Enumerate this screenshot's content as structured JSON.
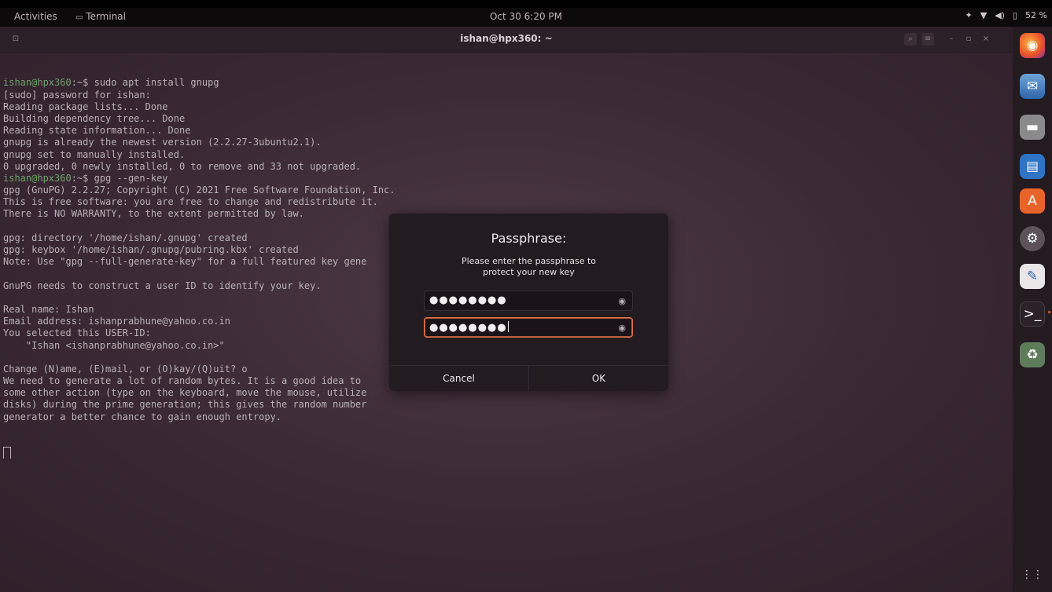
{
  "topbar": {
    "activities": "Activities",
    "app_menu": "Terminal",
    "clock": "Oct 30  6:20 PM",
    "battery": "52 %"
  },
  "terminal": {
    "window_title": "ishan@hpx360: ~",
    "lines": [
      {
        "prompt": "ishan@hpx360",
        "suffix": ":~$ ",
        "text": "sudo apt install gnupg"
      },
      {
        "text": "[sudo] password for ishan:"
      },
      {
        "text": "Reading package lists... Done"
      },
      {
        "text": "Building dependency tree... Done"
      },
      {
        "text": "Reading state information... Done"
      },
      {
        "text": "gnupg is already the newest version (2.2.27-3ubuntu2.1)."
      },
      {
        "text": "gnupg set to manually installed."
      },
      {
        "text": "0 upgraded, 0 newly installed, 0 to remove and 33 not upgraded."
      },
      {
        "prompt": "ishan@hpx360",
        "suffix": ":~$ ",
        "text": "gpg --gen-key"
      },
      {
        "text": "gpg (GnuPG) 2.2.27; Copyright (C) 2021 Free Software Foundation, Inc."
      },
      {
        "text": "This is free software: you are free to change and redistribute it."
      },
      {
        "text": "There is NO WARRANTY, to the extent permitted by law."
      },
      {
        "text": ""
      },
      {
        "text": "gpg: directory '/home/ishan/.gnupg' created"
      },
      {
        "text": "gpg: keybox '/home/ishan/.gnupg/pubring.kbx' created"
      },
      {
        "text": "Note: Use \"gpg --full-generate-key\" for a full featured key gene"
      },
      {
        "text": ""
      },
      {
        "text": "GnuPG needs to construct a user ID to identify your key."
      },
      {
        "text": ""
      },
      {
        "text": "Real name: Ishan"
      },
      {
        "text": "Email address: ishanprabhune@yahoo.co.in"
      },
      {
        "text": "You selected this USER-ID:"
      },
      {
        "text": "    \"Ishan <ishanprabhune@yahoo.co.in>\""
      },
      {
        "text": ""
      },
      {
        "text": "Change (N)ame, (E)mail, or (O)kay/(Q)uit? o"
      },
      {
        "text": "We need to generate a lot of random bytes. It is a good idea to"
      },
      {
        "text": "some other action (type on the keyboard, move the mouse, utilize"
      },
      {
        "text": "disks) during the prime generation; this gives the random number"
      },
      {
        "text": "generator a better chance to gain enough entropy."
      }
    ]
  },
  "dialog": {
    "title": "Passphrase:",
    "message_line1": "Please enter the passphrase to",
    "message_line2": "protect your new key",
    "field1_value": "●●●●●●●●",
    "field2_value": "●●●●●●●●",
    "cancel_label": "Cancel",
    "ok_label": "OK"
  },
  "icons": {
    "window_menu": "terminal-icon",
    "search": "search-icon",
    "hamburger": "menu-icon",
    "minimize": "minimize-icon",
    "maximize": "maximize-icon",
    "close": "close-icon",
    "eye": "eye-icon"
  },
  "colors": {
    "accent": "#e2734a",
    "prompt": "#6ea16a"
  }
}
